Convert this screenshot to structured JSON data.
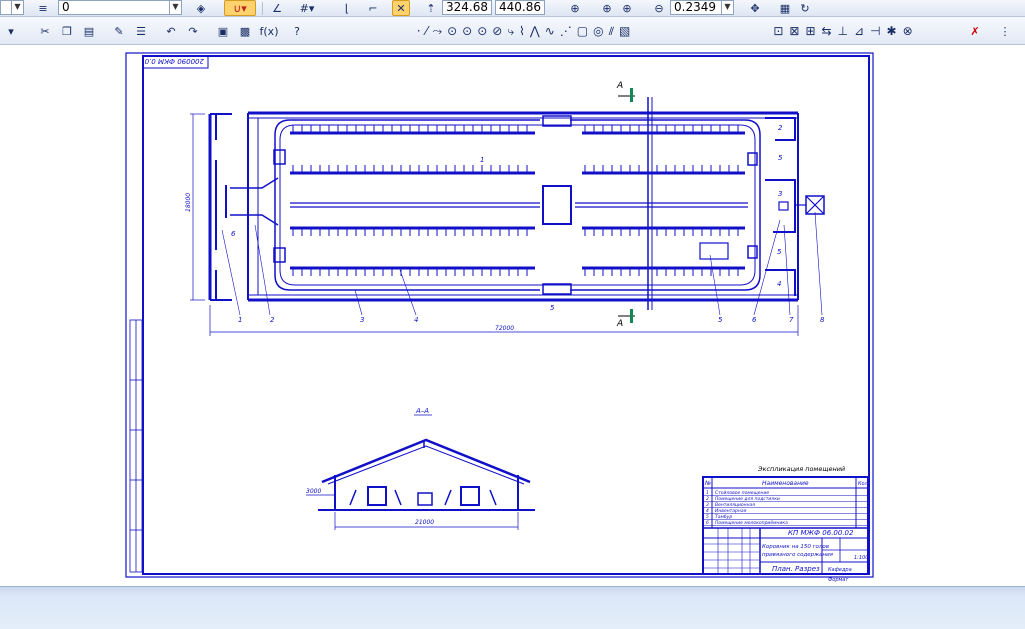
{
  "toolbar_top": {
    "layer_value": "0",
    "coord_x": "324.68",
    "coord_y": "440.86",
    "zoom": "0.2349"
  },
  "drawing": {
    "rotated_stamp": "200090 ФКМ 0.0",
    "section_marker_top": "А",
    "section_marker_bottom": "А",
    "section_title": "А–А",
    "room_labels": [
      "1",
      "2",
      "3",
      "4",
      "5",
      "5",
      "5",
      "6"
    ],
    "callouts": [
      "1",
      "2",
      "3",
      "4",
      "5",
      "6",
      "7",
      "8"
    ],
    "dim_overall_length": "72000",
    "dim_width": "18000",
    "section_dim_width": "21000",
    "section_dim_side": "3000"
  },
  "title_block": {
    "table_caption": "Экспликация помещений",
    "col_num": "№",
    "col_name": "Наименование",
    "col_area": "Кол",
    "rows": [
      {
        "num": "1",
        "name": "Стойловое помещение"
      },
      {
        "num": "2",
        "name": "Помещение для подстилки"
      },
      {
        "num": "3",
        "name": "Вентиляционная"
      },
      {
        "num": "4",
        "name": "Инвентарная"
      },
      {
        "num": "5",
        "name": "Тамбур"
      },
      {
        "num": "6",
        "name": "Помещение молокоприёмника"
      }
    ],
    "doc_code": "КП МЖФ 06.00.02",
    "project_title_line1": "Коровник на 150 голов",
    "project_title_line2": "привязного содержания",
    "sheet_title": "План. Разрез",
    "scale": "1:100",
    "org": "Кафедра",
    "format": "Формат"
  }
}
